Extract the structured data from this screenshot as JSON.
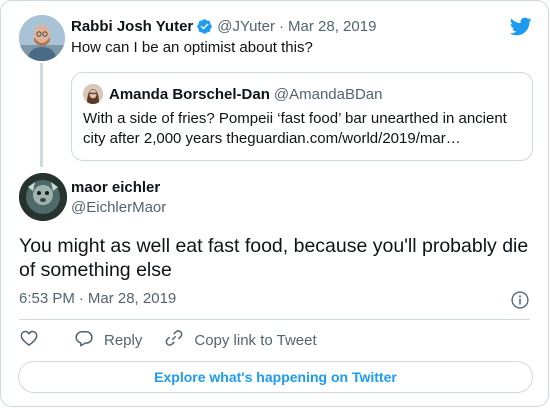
{
  "parent_tweet": {
    "name": "Rabbi Josh Yuter",
    "handle": "@JYuter",
    "separator": "·",
    "date": "Mar 28, 2019",
    "text": "How can I be an optimist about this?"
  },
  "quoted_tweet": {
    "name": "Amanda Borschel-Dan",
    "handle": "@AmandaBDan",
    "text": "With a side of fries? Pompeii ‘fast food’ bar unearthed in ancient city after 2,000 years theguardian.com/world/2019/mar…"
  },
  "main_tweet": {
    "name": "maor eichler",
    "handle": "@EichlerMaor",
    "text": "You might as well eat fast food, because you'll probably die of something else",
    "time": "6:53 PM",
    "separator": "·",
    "date": "Mar 28, 2019"
  },
  "actions": {
    "reply_label": "Reply",
    "copy_label": "Copy link to Tweet"
  },
  "explore_label": "Explore what's happening on Twitter",
  "icons": {
    "brand": "twitter-bird-icon",
    "verified": "verified-badge-icon",
    "info": "info-icon",
    "like": "heart-icon",
    "reply": "reply-icon",
    "copy": "link-icon"
  },
  "colors": {
    "accent": "#1d9bf0",
    "text": "#0f1419",
    "secondary": "#536471",
    "border": "#cfd9de"
  }
}
